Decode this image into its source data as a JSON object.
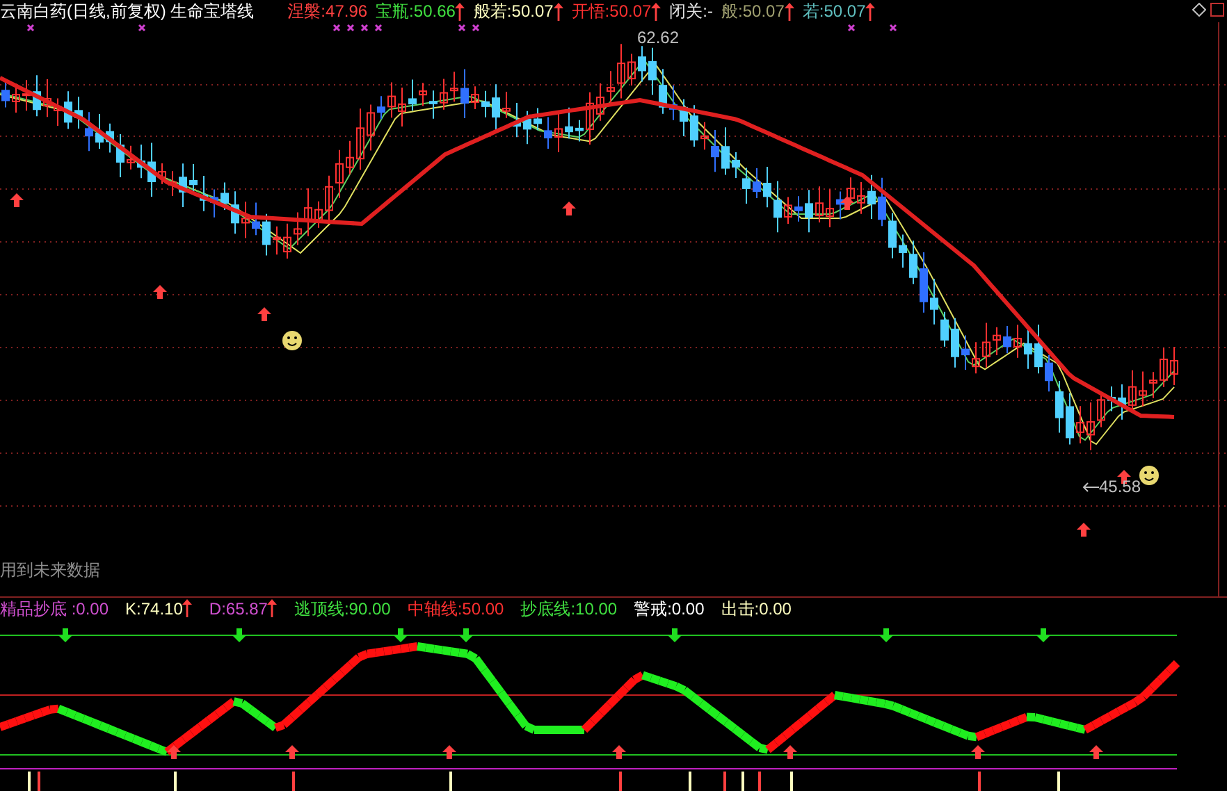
{
  "title": "云南白药(日线,前复权) 生命宝塔线",
  "indicators": [
    {
      "label": "涅槃:",
      "value": "47.96",
      "color": "#ff4040",
      "arrow": false
    },
    {
      "label": "宝瓶:",
      "value": "50.66",
      "color": "#40e040",
      "arrow": true
    },
    {
      "label": "般若:",
      "value": "50.07",
      "color": "#ffffc0",
      "arrow": true
    },
    {
      "label": "开悟:",
      "value": "50.07",
      "color": "#ff3030",
      "arrow": true
    },
    {
      "label": "闭关:",
      "value": "-",
      "color": "#e0e0e0",
      "arrow": false
    },
    {
      "label": "般:",
      "value": "50.07",
      "color": "#a0a070",
      "arrow": true
    },
    {
      "label": "若:",
      "value": "50.07",
      "color": "#60c0c0",
      "arrow": true
    }
  ],
  "price_labels": [
    "62.62",
    "45.58"
  ],
  "note": "用到未来数据",
  "lower_indicators": [
    {
      "label": "精品抄底 :",
      "value": "0.00",
      "color": "#d050d0",
      "arrow": false
    },
    {
      "label": "K:",
      "value": "74.10",
      "color": "#ffffc0",
      "arrow": true
    },
    {
      "label": "D:",
      "value": "65.87",
      "color": "#d050d0",
      "arrow": true
    },
    {
      "label": "逃顶线:",
      "value": "90.00",
      "color": "#40e040",
      "arrow": false
    },
    {
      "label": "中轴线:",
      "value": "50.00",
      "color": "#ff3030",
      "arrow": false
    },
    {
      "label": "抄底线:",
      "value": "10.00",
      "color": "#40e040",
      "arrow": false
    },
    {
      "label": "警戒:",
      "value": "0.00",
      "color": "#ffffff",
      "arrow": false
    },
    {
      "label": "出击:",
      "value": "0.00",
      "color": "#ffffc0",
      "arrow": false
    }
  ]
}
